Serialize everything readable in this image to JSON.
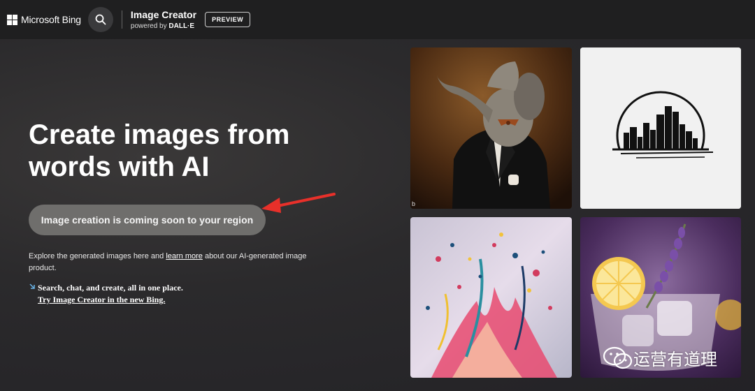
{
  "header": {
    "logo_text": "Microsoft Bing",
    "app_title": "Image Creator",
    "powered_prefix": "powered by ",
    "powered_brand": "DALL·E",
    "preview_badge": "PREVIEW"
  },
  "hero": {
    "title": "Create images from words with AI",
    "cta_label": "Image creation is coming soon to your region"
  },
  "explore": {
    "text_before": "Explore the generated images here and ",
    "link_label": "learn more",
    "text_after": " about our AI-generated image product."
  },
  "promo": {
    "line1": "Search, chat, and create, all in one place.",
    "link_label": "Try Image Creator in the new Bing."
  },
  "gallery": {
    "tile_badge": "b"
  },
  "watermark": {
    "text": "运营有道理"
  },
  "colors": {
    "cta_bg": "#6f6e6c",
    "arrow": "#e8302a",
    "topbar_bg": "#1f1f20"
  }
}
